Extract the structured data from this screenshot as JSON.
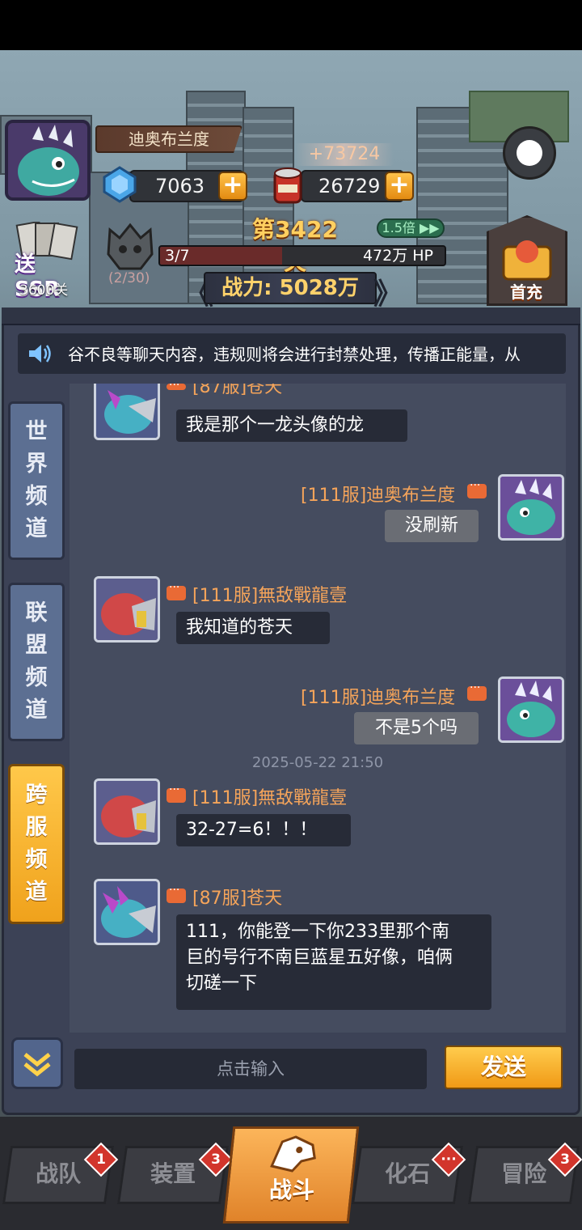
{
  "header": {
    "player_name": "迪奥布兰度",
    "gems": "7063",
    "food": "26729",
    "food_gain": "+73724",
    "stage": "第3422关",
    "speed": "1.5倍",
    "wave": "3/7",
    "boss_hp": "472万 HP",
    "hp_fraction": 0.43,
    "boss_progress": "(2/30)",
    "power": "战力: 5028万",
    "send_ssr_label": "送SSR",
    "send_ssr_stage": "3600关",
    "first_pay_label": "首充"
  },
  "chat": {
    "notice": "谷不良等聊天内容，违规则将会进行封禁处理，传播正能量，从",
    "tabs": [
      {
        "label": "世界频道"
      },
      {
        "label": "联盟频道"
      },
      {
        "label": "跨服频道"
      }
    ],
    "messages": [
      {
        "name": "[87服]苍天",
        "text": "我是那个一龙头像的龙",
        "mine": false
      },
      {
        "name": "[111服]迪奥布兰度",
        "text": "没刷新",
        "mine": true
      },
      {
        "name": "[111服]無敌戰龍壹",
        "text": "我知道的苍天",
        "mine": false
      },
      {
        "name": "[111服]迪奥布兰度",
        "text": "不是5个吗",
        "mine": true
      },
      {
        "name": "[111服]無敌戰龍壹",
        "text": "32-27=6！！！",
        "mine": false
      },
      {
        "name": "[87服]苍天",
        "lines": [
          "111，你能登一下你233里那个南",
          "巨的号行不南巨蓝星五好像，咱俩",
          "切磋一下"
        ],
        "mine": false
      }
    ],
    "timestamp": "2025-05-22 21:50",
    "input_placeholder": "点击输入",
    "send_label": "发送"
  },
  "nav": {
    "items": [
      {
        "label": "战队",
        "badge": "1"
      },
      {
        "label": "装置",
        "badge": "3"
      },
      {
        "label": "战斗",
        "badge": ""
      },
      {
        "label": "化石",
        "badge": "···"
      },
      {
        "label": "冒险",
        "badge": "3"
      }
    ]
  },
  "colors": {
    "accent": "#f5a45a",
    "active_tab": "#f0a21c",
    "badge": "#d2352c"
  }
}
